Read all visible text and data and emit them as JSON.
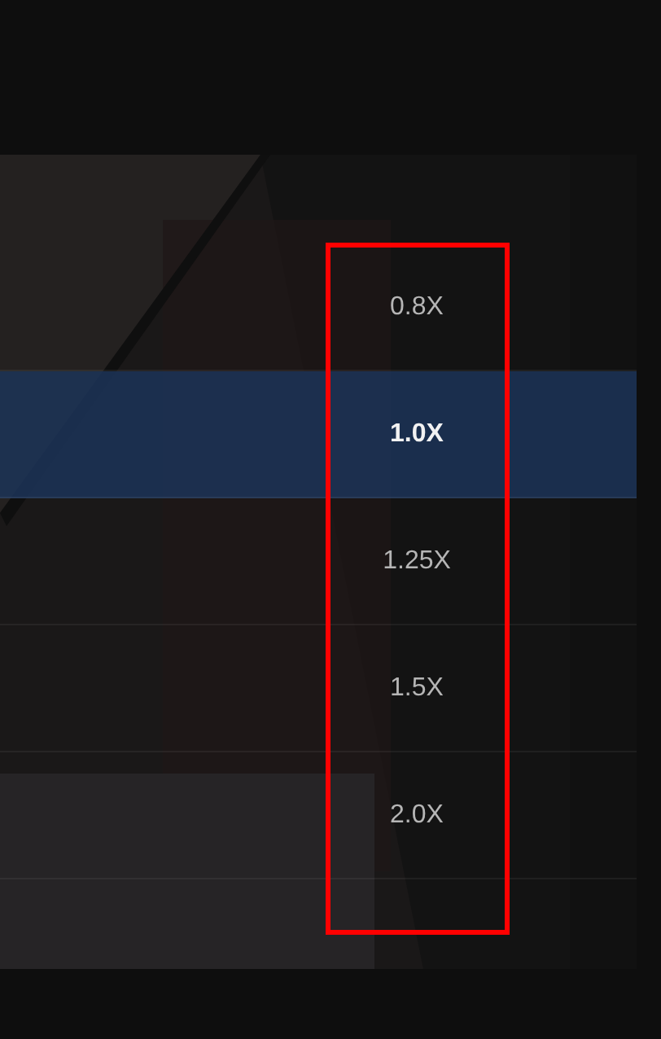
{
  "speed_menu": {
    "items": [
      {
        "label": "0.8X",
        "selected": false
      },
      {
        "label": "1.0X",
        "selected": true
      },
      {
        "label": "1.25X",
        "selected": false
      },
      {
        "label": "1.5X",
        "selected": false
      },
      {
        "label": "2.0X",
        "selected": false
      }
    ]
  }
}
